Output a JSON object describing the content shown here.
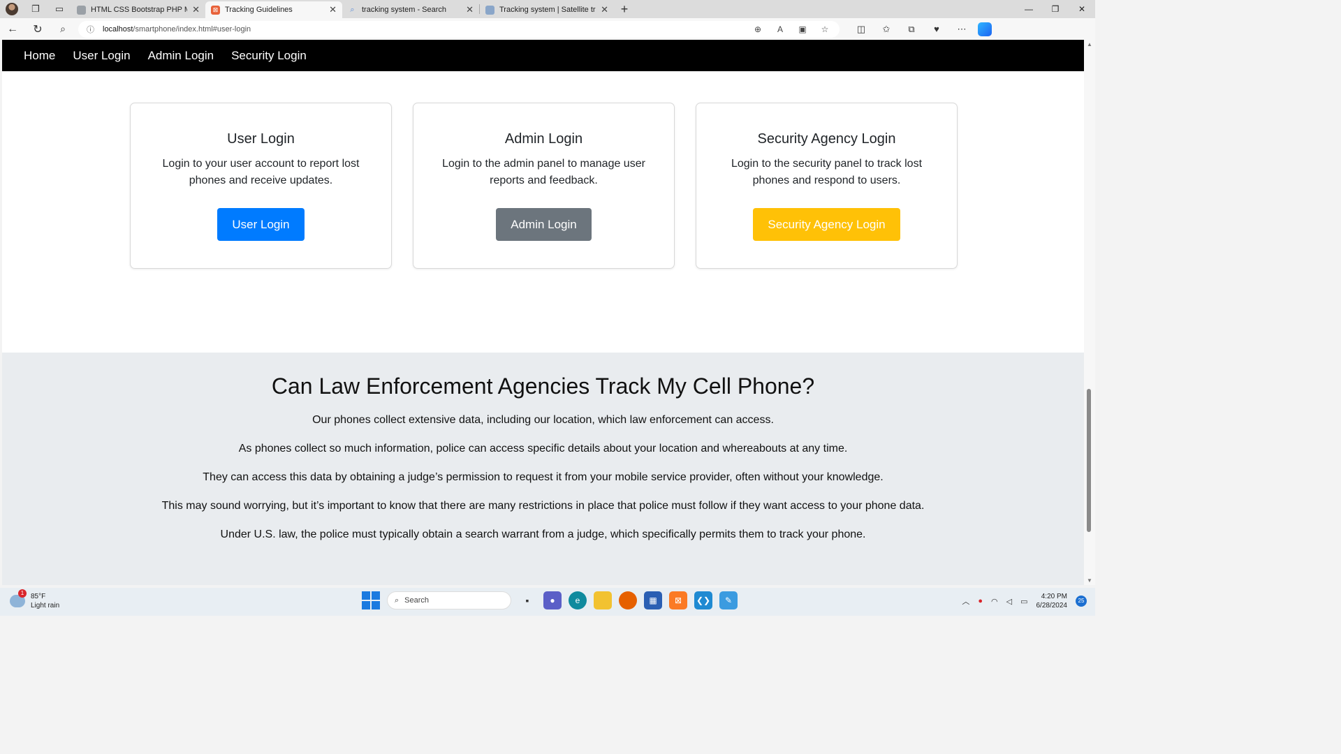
{
  "browser": {
    "tabs": [
      {
        "title": "HTML CSS Bootstrap PHP MYSQL",
        "favicon_color": "#9aa0a6",
        "active": false
      },
      {
        "title": "Tracking Guidelines",
        "favicon_color": "#e8623a",
        "active": true
      },
      {
        "title": "tracking system - Search",
        "favicon_color": "#5b8dd9",
        "active": false
      },
      {
        "title": "Tracking system | Satellite tracking",
        "favicon_color": "#8aa6c9",
        "active": false
      }
    ],
    "url_host": "localhost",
    "url_path": "/smartphone/index.html#user-login"
  },
  "nav": {
    "items": [
      "Home",
      "User Login",
      "Admin Login",
      "Security Login"
    ]
  },
  "cards": [
    {
      "title": "User Login",
      "text": "Login to your user account to report lost phones and receive updates.",
      "button": "User Login",
      "button_color": "#007bff"
    },
    {
      "title": "Admin Login",
      "text": "Login to the admin panel to manage user reports and feedback.",
      "button": "Admin Login",
      "button_color": "#6c757d"
    },
    {
      "title": "Security Agency Login",
      "text": "Login to the security panel to track lost phones and respond to users.",
      "button": "Security Agency Login",
      "button_color": "#ffc107"
    }
  ],
  "info": {
    "heading": "Can Law Enforcement Agencies Track My Cell Phone?",
    "paragraphs": [
      "Our phones collect extensive data, including our location, which law enforcement can access.",
      "As phones collect so much information, police can access specific details about your location and whereabouts at any time.",
      "They can access this data by obtaining a judge’s permission to request it from your mobile service provider, often without your knowledge.",
      "This may sound worrying, but it’s important to know that there are many restrictions in place that police must follow if they want access to your phone data.",
      "Under U.S. law, the police must typically obtain a search warrant from a judge, which specifically permits them to track your phone."
    ]
  },
  "taskbar": {
    "weather_badge": "1",
    "temperature": "85°F",
    "condition": "Light rain",
    "search_placeholder": "Search",
    "time": "4:20 PM",
    "date": "6/28/2024",
    "notification_count": "25"
  }
}
